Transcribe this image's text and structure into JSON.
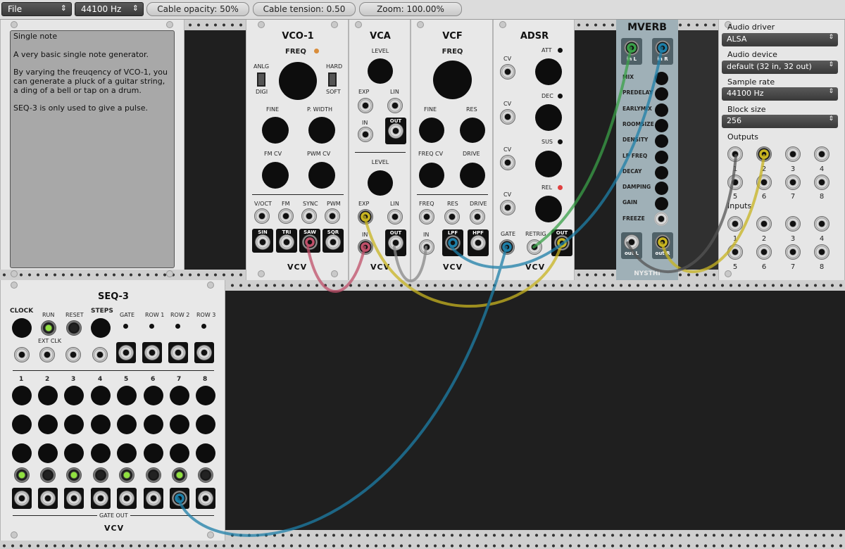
{
  "toolbar": {
    "file_label": "File",
    "sample_rate_label": "44100 Hz",
    "cable_opacity": "Cable opacity: 50%",
    "cable_tension": "Cable tension: 0.50",
    "zoom": "Zoom: 100.00%"
  },
  "notes": {
    "text": "Single note\n\nA very basic single note generator.\n\nBy varying the freuqency of VCO-1, you can generate a pluck of a guitar string, a ding of a bell or tap on a drum.\n\nSEQ-3 is only used to give a pulse."
  },
  "vco": {
    "title": "VCO-1",
    "freq": "FREQ",
    "anlg": "ANLG",
    "digi": "DIGI",
    "hard": "HARD",
    "soft": "SOFT",
    "fine": "FINE",
    "pwidth": "P. WIDTH",
    "fmcv": "FM CV",
    "pwmcv": "PWM CV",
    "in_labels": [
      "V/OCT",
      "FM",
      "SYNC",
      "PWM"
    ],
    "out_labels": [
      "SIN",
      "TRI",
      "SAW",
      "SQR"
    ]
  },
  "vca": {
    "title": "VCA",
    "level1": "LEVEL",
    "exp1": "EXP",
    "lin1": "LIN",
    "in1": "IN",
    "out1": "OUT",
    "level2": "LEVEL",
    "exp2": "EXP",
    "lin2": "LIN",
    "in2": "IN",
    "out2": "OUT"
  },
  "vcf": {
    "title": "VCF",
    "freq": "FREQ",
    "fine": "FINE",
    "res": "RES",
    "freqcv": "FREQ CV",
    "drive": "DRIVE",
    "in_labels": [
      "FREQ",
      "RES",
      "DRIVE"
    ],
    "in": "IN",
    "lpf": "LPF",
    "hpf": "HPF"
  },
  "adsr": {
    "title": "ADSR",
    "att": "ATT",
    "dec": "DEC",
    "sus": "SUS",
    "rel": "REL",
    "cv": "CV",
    "gate": "GATE",
    "retrig": "RETRIG",
    "out": "OUT"
  },
  "mverb": {
    "title": "MVERB",
    "inL": "in L",
    "inR": "in R",
    "params": [
      "MIX",
      "PREDELAY",
      "EARLYMIX",
      "ROOMSIZE",
      "DENSITY",
      "LP FREQ",
      "DECAY",
      "DAMPING",
      "GAIN",
      "FREEZE"
    ],
    "outL": "out L",
    "outR": "out R",
    "brand": "NYSTHI"
  },
  "audio": {
    "driver_label": "Audio driver",
    "driver": "ALSA",
    "device_label": "Audio device",
    "device": "default (32 in, 32 out)",
    "rate_label": "Sample rate",
    "rate": "44100 Hz",
    "block_label": "Block size",
    "block": "256",
    "outputs_label": "Outputs",
    "inputs_label": "Inputs",
    "nums": [
      "1",
      "2",
      "3",
      "4",
      "5",
      "6",
      "7",
      "8"
    ]
  },
  "seq": {
    "title": "SEQ-3",
    "clock": "CLOCK",
    "run": "RUN",
    "reset": "RESET",
    "steps": "STEPS",
    "extclk": "EXT CLK",
    "gate": "GATE",
    "row1": "ROW 1",
    "row2": "ROW 2",
    "row3": "ROW 3",
    "steps_nums": [
      "1",
      "2",
      "3",
      "4",
      "5",
      "6",
      "7",
      "8"
    ],
    "gate_out": "GATE OUT"
  },
  "brand": "VCV",
  "colors": {
    "cable_red": "#c0506a",
    "cable_yellow": "#c8b420",
    "cable_blue": "#1e7fa8",
    "cable_green": "#3aa048",
    "cable_gray": "#555555",
    "led_green": "#90e040"
  }
}
